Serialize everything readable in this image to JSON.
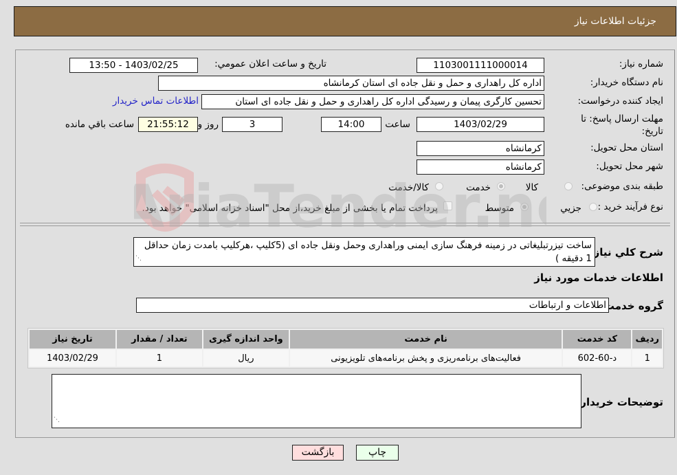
{
  "header": {
    "title": "جزئیات اطلاعات نیاز"
  },
  "fields": {
    "need_number": {
      "label": "شماره نیاز:",
      "value": "1103001111000014"
    },
    "announce_datetime": {
      "label": "تاریخ و ساعت اعلان عمومي:",
      "value": "1403/02/25 - 13:50"
    },
    "buyer_org": {
      "label": "نام دستگاه خریدار:",
      "value": "اداره کل راهداری و حمل و نقل جاده ای استان کرمانشاه"
    },
    "requester": {
      "label": "ایجاد کننده درخواست:",
      "value": "تحسین کارگری پیمان و رسیدگی اداره کل راهداری و حمل و نقل جاده ای استان",
      "link": "اطلاعات تماس خریدار"
    },
    "deadline": {
      "label": "مهلت ارسال پاسخ: تا تاریخ:",
      "date": "1403/02/29",
      "time_label": "ساعت",
      "time": "14:00",
      "days": "3",
      "days_label": "روز و",
      "remaining": "21:55:12",
      "remaining_label": "ساعت باقي مانده"
    },
    "province": {
      "label": "استان محل تحویل:",
      "value": "کرمانشاه"
    },
    "city": {
      "label": "شهر محل تحویل:",
      "value": "کرمانشاه"
    },
    "category": {
      "label": "طبقه بندی موضوعی:",
      "options": [
        "کالا",
        "خدمت",
        "کالا/خدمت"
      ],
      "selected": "خدمت"
    },
    "process": {
      "label": "نوع فرآیند خرید :",
      "options": [
        "جزيي",
        "متوسط"
      ],
      "selected": "متوسط",
      "checkbox_text": "پرداخت تمام یا بخشی از مبلغ خرید،از محل \"اسناد خزانه اسلامی\" خواهد بود."
    }
  },
  "description": {
    "label": "شرح کلي نیاز:",
    "value": "ساخت تیزرتبلیغاتی در زمینه فرهنگ سازی ایمنی وراهداری وحمل ونقل جاده ای (5کلیپ ،هرکلیپ بامدت زمان حداقل 1 دقیقه )"
  },
  "services": {
    "section_title": "اطلاعات خدمات مورد نیاز",
    "group_label": "گروه خدمت:",
    "group_value": "اطلاعات و ارتباطات",
    "columns": [
      "ردیف",
      "کد خدمت",
      "نام خدمت",
      "واحد اندازه گیری",
      "تعداد / مقدار",
      "تاریخ نیاز"
    ],
    "rows": [
      [
        "1",
        "د-60-602",
        "فعالیت‌های برنامه‌ریزی و پخش برنامه‌های تلویزیونی",
        "ریال",
        "1",
        "1403/02/29"
      ]
    ]
  },
  "buyer_notes": {
    "label": "توضیحات خریدار:",
    "value": ""
  },
  "buttons": {
    "print": "چاپ",
    "back": "بازگشت"
  },
  "watermark": {
    "text": "AriaTender.neT"
  },
  "colors": {
    "header_bg": "#8c6c43",
    "print_bg": "#eaffea",
    "back_bg": "#ffdede",
    "link": "#2323c8"
  }
}
